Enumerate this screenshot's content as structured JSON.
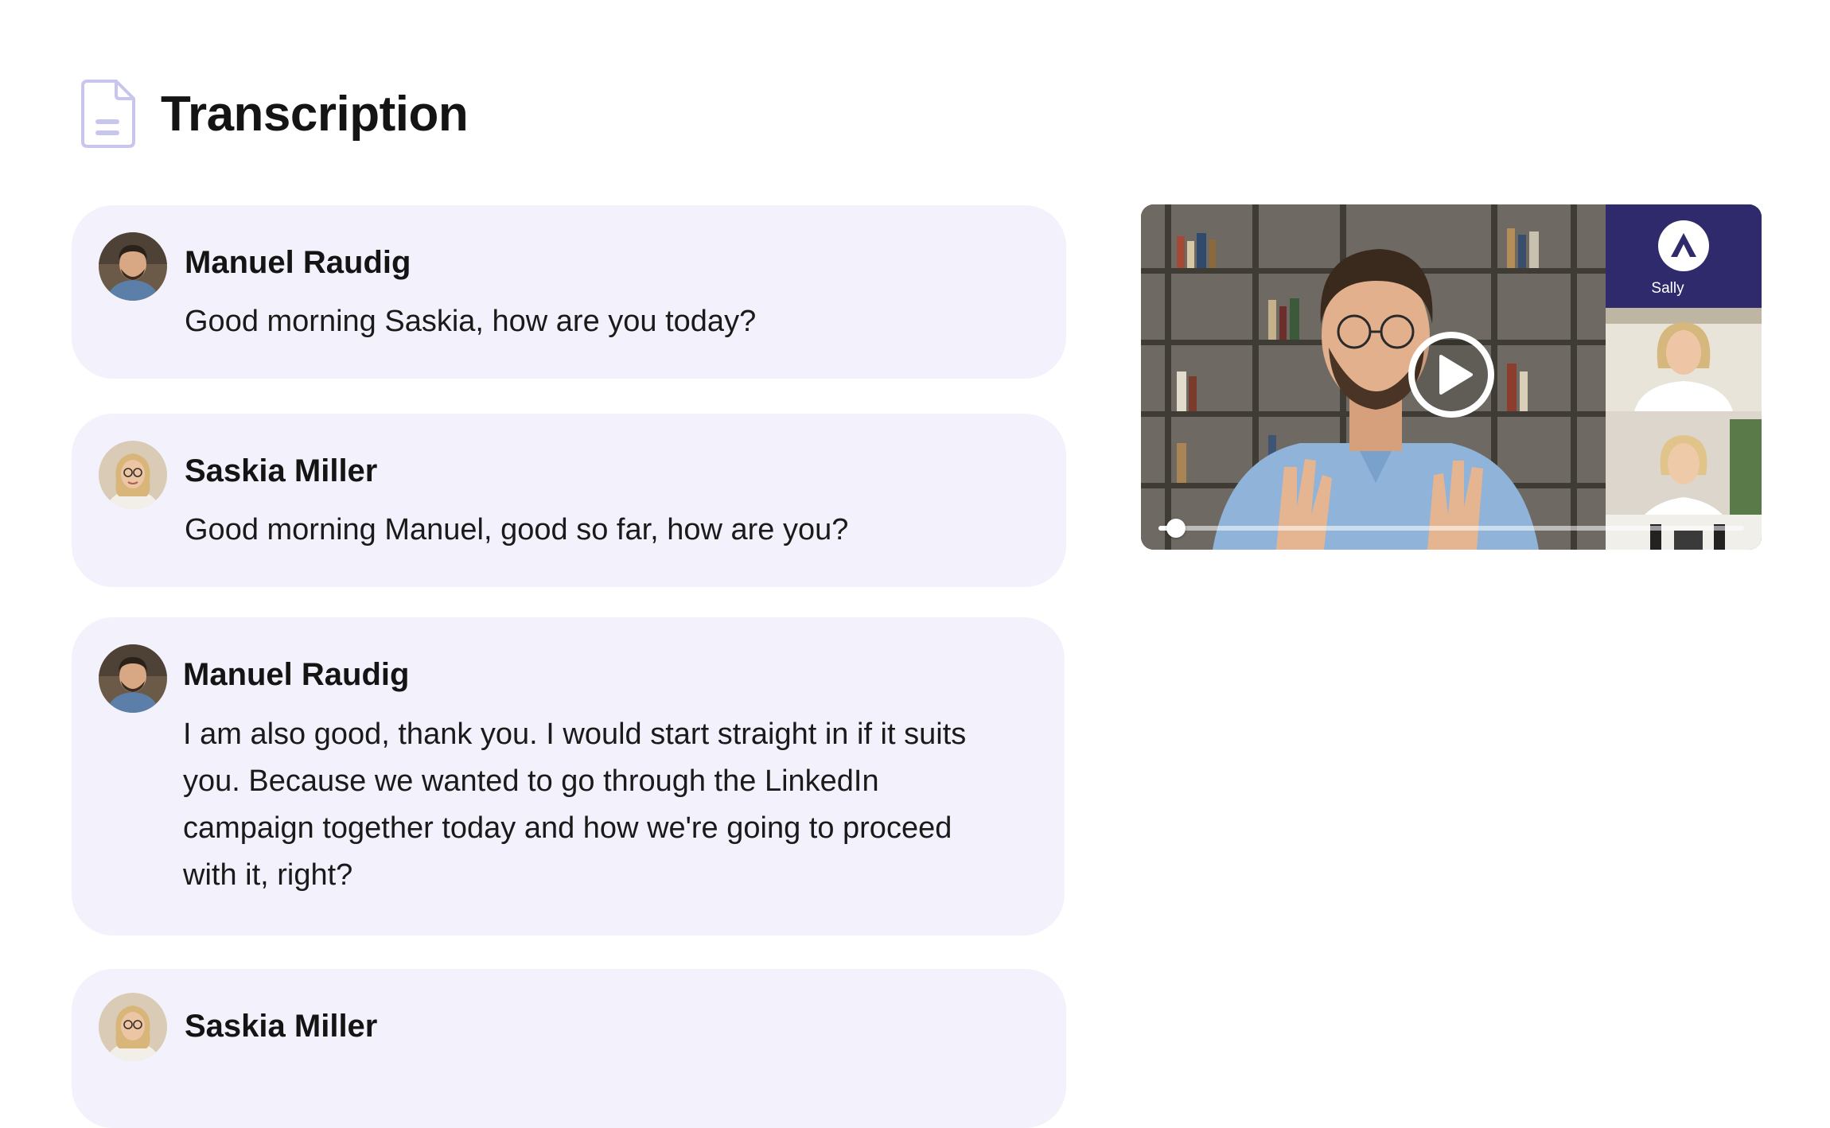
{
  "header": {
    "title": "Transcription",
    "icon": "document-icon",
    "icon_color": "#c9c6ee"
  },
  "messages": [
    {
      "speaker": "Manuel Raudig",
      "text": "Good morning Saskia, how are you today?",
      "avatar": "manuel"
    },
    {
      "speaker": "Saskia Miller",
      "text": "Good morning Manuel, good so far, how are you?",
      "avatar": "saskia"
    },
    {
      "speaker": "Manuel Raudig",
      "text": "I am also good, thank you. I would start straight in if it suits you. Because we wanted to go through the LinkedIn campaign together today and how we're going to proceed with it, right?",
      "avatar": "manuel"
    },
    {
      "speaker": "Saskia Miller",
      "text": "",
      "avatar": "saskia"
    }
  ],
  "video": {
    "assistant_label": "Sally",
    "progress": 0.03,
    "play_icon": "play-icon",
    "assistant_icon": "sally-logo-icon"
  },
  "colors": {
    "card_background": "#f3f2fc",
    "title_text": "#141414",
    "assistant_panel": "#2f2a6b"
  }
}
